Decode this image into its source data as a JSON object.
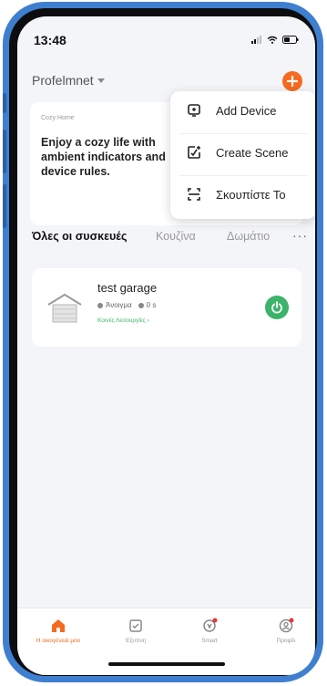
{
  "status": {
    "time": "13:48"
  },
  "header": {
    "home_name": "Profelmnet",
    "add_icon": "plus-icon",
    "accent": "#f56a1f"
  },
  "card": {
    "small_label": "Cozy Home",
    "title": "Enjoy a cozy life with ambient indicators and device rules."
  },
  "menu": {
    "items": [
      {
        "label": "Add Device",
        "icon": "add-device-icon"
      },
      {
        "label": "Create Scene",
        "icon": "create-scene-icon"
      },
      {
        "label": "Σκουπίστε Το",
        "icon": "scan-icon"
      }
    ]
  },
  "tabs": {
    "items": [
      {
        "label": "Όλες οι συσκευές",
        "active": true
      },
      {
        "label": "Κουζίνα",
        "active": false
      },
      {
        "label": "Δωμάτιο",
        "active": false
      }
    ],
    "more": "···"
  },
  "device": {
    "name": "test garage",
    "state": "Άνοιγμα",
    "time": "0 s",
    "functions": "Κοινές Λειτουργίες ›",
    "power_color": "#3bb36a"
  },
  "tabbar": {
    "items": [
      {
        "label": "Η οικογένειά μου",
        "icon": "home-icon",
        "active": true
      },
      {
        "label": "Έξυπνη",
        "icon": "smart-check-icon",
        "active": false
      },
      {
        "label": "Smart",
        "icon": "smart-icon",
        "active": false
      },
      {
        "label": "Προφίλ",
        "icon": "profile-icon",
        "active": false
      }
    ]
  }
}
